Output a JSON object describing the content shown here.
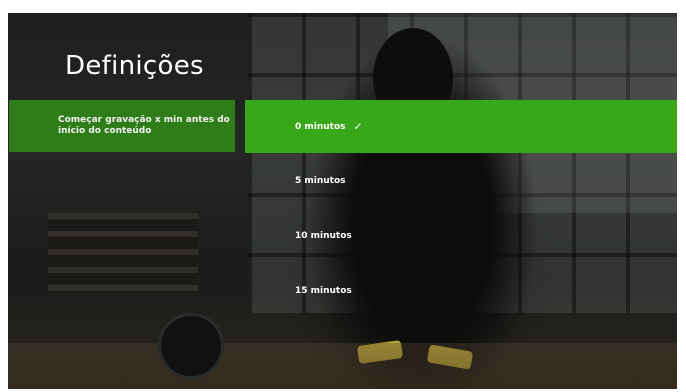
{
  "header": {
    "title": "Definições"
  },
  "setting": {
    "label": "Começar gravação x min antes do início do conteúdo"
  },
  "options": [
    {
      "label": "0 minutos",
      "selected": true
    },
    {
      "label": "5 minutos",
      "selected": false
    },
    {
      "label": "10 minutos",
      "selected": false
    },
    {
      "label": "15 minutos",
      "selected": false
    }
  ],
  "icons": {
    "selected_marker": "checkmark-icon"
  },
  "colors": {
    "accent": "#39a818",
    "panel": "#2f7d18",
    "text": "#ffffff"
  }
}
